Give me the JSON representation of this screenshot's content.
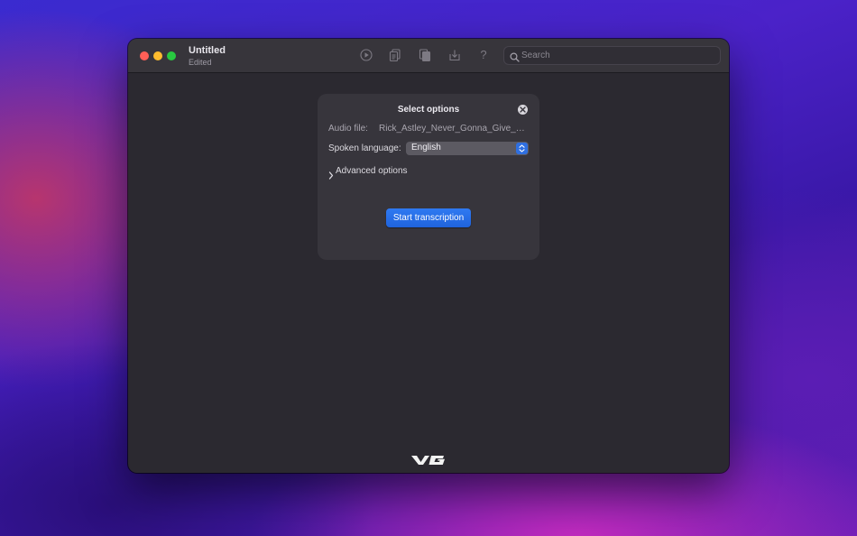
{
  "window": {
    "title": "Untitled",
    "subtitle": "Edited"
  },
  "toolbar": {
    "icons": [
      "play-icon",
      "copy-document-icon",
      "paste-document-icon",
      "export-icon",
      "help-icon"
    ],
    "help_glyph": "?",
    "search": {
      "placeholder": "Search",
      "value": ""
    }
  },
  "panel": {
    "title": "Select options",
    "audio_file_label": "Audio file:",
    "audio_file_value": "Rick_Astley_Never_Gonna_Give_Yo...",
    "language_label": "Spoken language:",
    "language_value": "English",
    "advanced_label": "Advanced options",
    "start_button": "Start transcription"
  },
  "footer": {
    "logo": "VG"
  },
  "colors": {
    "accent": "#2f6fe0",
    "window_bg": "#2b2930",
    "panel_bg": "#37353c"
  }
}
